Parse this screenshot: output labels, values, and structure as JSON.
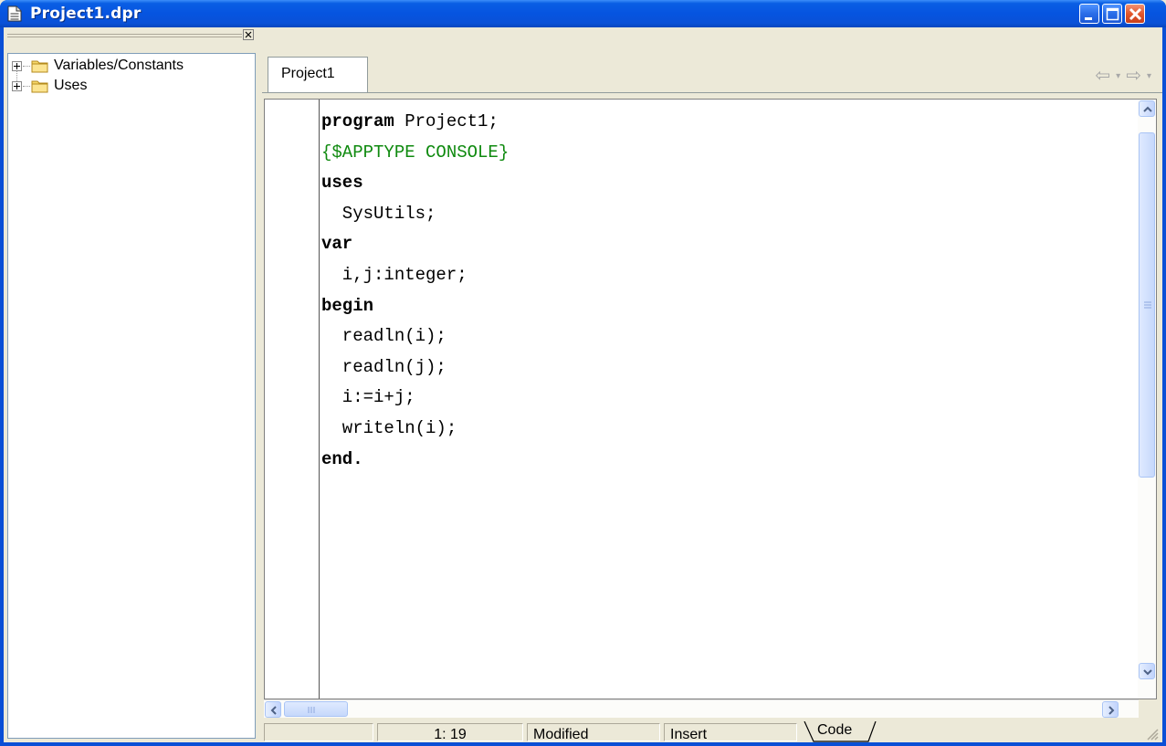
{
  "window": {
    "title": "Project1.dpr",
    "title_icon": "document-icon"
  },
  "explorer": {
    "items": [
      {
        "label": "Variables/Constants",
        "icon": "folder-icon"
      },
      {
        "label": "Uses",
        "icon": "folder-icon"
      }
    ]
  },
  "editor": {
    "tab_label": "Project1",
    "code_lines": [
      [
        {
          "t": "program",
          "k": "kw"
        },
        {
          "t": " Project1;",
          "k": "plain"
        }
      ],
      [
        {
          "t": "{$APPTYPE CONSOLE}",
          "k": "dir"
        }
      ],
      [
        {
          "t": "uses",
          "k": "kw"
        }
      ],
      [
        {
          "t": "  SysUtils;",
          "k": "plain"
        }
      ],
      [
        {
          "t": "var",
          "k": "kw"
        }
      ],
      [
        {
          "t": "  i,j:integer;",
          "k": "plain"
        }
      ],
      [
        {
          "t": "begin",
          "k": "kw"
        }
      ],
      [
        {
          "t": "  readln(i);",
          "k": "plain"
        }
      ],
      [
        {
          "t": "  readln(j);",
          "k": "plain"
        }
      ],
      [
        {
          "t": "  i:=i+j;",
          "k": "plain"
        }
      ],
      [
        {
          "t": "  writeln(i);",
          "k": "plain"
        }
      ],
      [
        {
          "t": "end.",
          "k": "kw"
        }
      ]
    ]
  },
  "statusbar": {
    "position": "1: 19",
    "modified": "Modified",
    "mode": "Insert",
    "view_tab": "Code"
  },
  "colors": {
    "titlebar": "#0654e0",
    "directive": "#0f8a0f",
    "close_button": "#e2572c"
  }
}
